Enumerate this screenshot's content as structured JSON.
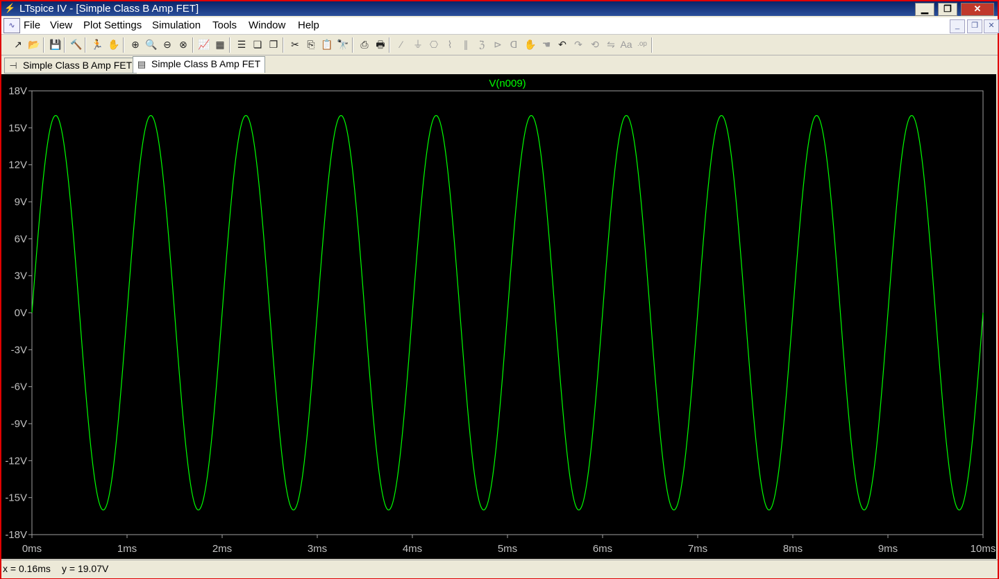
{
  "window": {
    "title": "LTspice IV - [Simple Class B Amp FET]",
    "minimize_glyph": "▁",
    "restore_glyph": "❐",
    "close_glyph": "✕"
  },
  "menubar": {
    "items": [
      "File",
      "View",
      "Plot Settings",
      "Simulation",
      "Tools",
      "Window",
      "Help"
    ],
    "mdi_minimize_glyph": "_",
    "mdi_restore_glyph": "❐",
    "mdi_close_glyph": "✕"
  },
  "toolbar": {
    "buttons": [
      {
        "name": "new-schematic-icon",
        "glyph": "↗",
        "enabled": true
      },
      {
        "name": "open-icon",
        "glyph": "📂",
        "enabled": true
      },
      {
        "name": "save-icon",
        "glyph": "💾",
        "enabled": true
      },
      {
        "name": "control-panel-icon",
        "glyph": "🔨",
        "enabled": true
      },
      {
        "name": "run-icon",
        "glyph": "🏃",
        "enabled": true
      },
      {
        "name": "halt-icon",
        "glyph": "✋",
        "enabled": true
      },
      {
        "name": "zoom-area-icon",
        "glyph": "⊕",
        "enabled": true
      },
      {
        "name": "zoom-in-icon",
        "glyph": "🔍",
        "enabled": true
      },
      {
        "name": "zoom-out-icon",
        "glyph": "⊖",
        "enabled": true
      },
      {
        "name": "zoom-fit-icon",
        "glyph": "⊗",
        "enabled": true
      },
      {
        "name": "autorange-icon",
        "glyph": "📈",
        "enabled": true
      },
      {
        "name": "manual-limits-icon",
        "glyph": "▦",
        "enabled": true
      },
      {
        "name": "tile-horizontal-icon",
        "glyph": "☰",
        "enabled": true
      },
      {
        "name": "cascade-icon",
        "glyph": "❏",
        "enabled": true
      },
      {
        "name": "tile-windows-icon",
        "glyph": "❐",
        "enabled": true
      },
      {
        "name": "cut-icon",
        "glyph": "✂",
        "enabled": true
      },
      {
        "name": "copy-icon",
        "glyph": "⎘",
        "enabled": true
      },
      {
        "name": "paste-icon",
        "glyph": "📋",
        "enabled": true
      },
      {
        "name": "find-icon",
        "glyph": "🔭",
        "enabled": true
      },
      {
        "name": "print-preview-icon",
        "glyph": "⎙",
        "enabled": true
      },
      {
        "name": "print-icon",
        "glyph": "🖶",
        "enabled": true
      },
      {
        "name": "wire-icon",
        "glyph": "∕",
        "enabled": false
      },
      {
        "name": "ground-icon",
        "glyph": "⏚",
        "enabled": false
      },
      {
        "name": "label-net-icon",
        "glyph": "⎔",
        "enabled": false
      },
      {
        "name": "resistor-icon",
        "glyph": "⌇",
        "enabled": false
      },
      {
        "name": "capacitor-icon",
        "glyph": "∥",
        "enabled": false
      },
      {
        "name": "inductor-icon",
        "glyph": "ℨ",
        "enabled": false
      },
      {
        "name": "diode-icon",
        "glyph": "⊳",
        "enabled": false
      },
      {
        "name": "component-icon",
        "glyph": "ᗡ",
        "enabled": false
      },
      {
        "name": "move-icon",
        "glyph": "✋",
        "enabled": false
      },
      {
        "name": "drag-icon",
        "glyph": "☚",
        "enabled": false
      },
      {
        "name": "undo-icon",
        "glyph": "↶",
        "enabled": true
      },
      {
        "name": "redo-icon",
        "glyph": "↷",
        "enabled": false
      },
      {
        "name": "rotate-icon",
        "glyph": "⟲",
        "enabled": false
      },
      {
        "name": "mirror-icon",
        "glyph": "⇋",
        "enabled": false
      },
      {
        "name": "text-icon",
        "glyph": "Aa",
        "enabled": false
      },
      {
        "name": "spice-directive-icon",
        "glyph": ".op",
        "enabled": false
      }
    ]
  },
  "tabs": [
    {
      "label": "Simple Class B Amp FET",
      "icon": "schematic-icon",
      "glyph": "⊣",
      "active": false
    },
    {
      "label": "Simple Class B Amp FET",
      "icon": "waveform-icon",
      "glyph": "▤",
      "active": true
    }
  ],
  "colors": {
    "plot_background": "#000000",
    "trace": "#00ff00",
    "axis_text": "#c0c0c0",
    "window_border": "#e00000"
  },
  "chart_data": {
    "type": "line",
    "title": "V(n009)",
    "xlabel": "",
    "ylabel": "",
    "x_ticks": [
      "0ms",
      "1ms",
      "2ms",
      "3ms",
      "4ms",
      "5ms",
      "6ms",
      "7ms",
      "8ms",
      "9ms",
      "10ms"
    ],
    "y_ticks": [
      "18V",
      "15V",
      "12V",
      "9V",
      "6V",
      "3V",
      "0V",
      "-3V",
      "-6V",
      "-9V",
      "-12V",
      "-15V",
      "-18V"
    ],
    "xlim": [
      0,
      10
    ],
    "ylim": [
      -18,
      18
    ],
    "x_unit": "ms",
    "y_unit": "V",
    "grid": false,
    "series": [
      {
        "name": "V(n009)",
        "function": "sine",
        "amplitude": 16,
        "frequency_khz": 1,
        "phase_deg": 0,
        "x_start": 0,
        "x_end": 10
      }
    ]
  },
  "status": {
    "cursor_x": "x = 0.16ms",
    "cursor_y": "y = 19.07V"
  }
}
